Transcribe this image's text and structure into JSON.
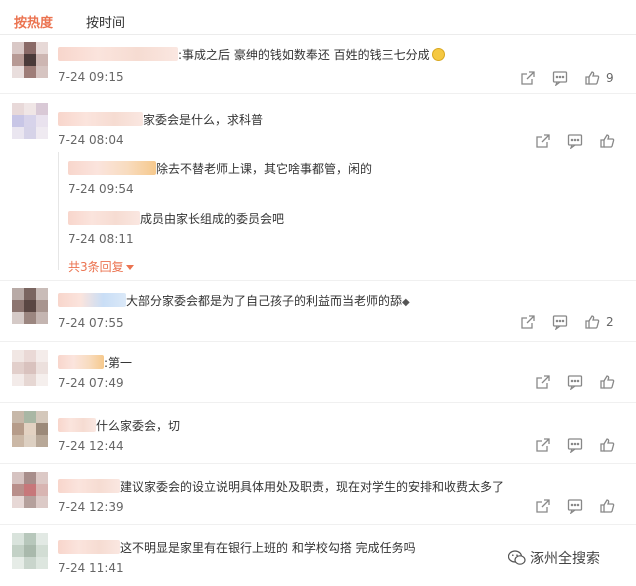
{
  "tabs": [
    {
      "label": "按热度",
      "active": true
    },
    {
      "label": "按时间",
      "active": false
    }
  ],
  "comments": [
    {
      "text": ":事成之后 豪绅的钱如数奉还 百姓的钱三七分成",
      "time": "7-24 09:15",
      "likes": "9",
      "has_emoji": "laughing-face"
    },
    {
      "text": "家委会是什么，求科普",
      "time": "7-24 08:04",
      "likes": ""
    },
    {
      "text": "大部分家委会都是为了自己孩子的利益而当老师的舔",
      "time": "7-24 07:55",
      "likes": "2",
      "has_emoji": "gem"
    },
    {
      "text": ":第一",
      "time": "7-24 07:49",
      "likes": ""
    },
    {
      "text": "什么家委会，切",
      "time": "7-24 12:44",
      "likes": ""
    },
    {
      "text": "建议家委会的设立说明具体用处及职责，现在对学生的安排和收费太多了",
      "time": "7-24 12:39",
      "likes": ""
    },
    {
      "text": "这不明显是家里有在银行上班的 和学校勾搭 完成任务吗",
      "time": "7-24 11:41",
      "likes": ""
    }
  ],
  "replies": [
    {
      "text": "除去不替老师上课，其它啥事都管，闲的",
      "time": "7-24 09:54"
    },
    {
      "text": "成员由家长组成的委员会吧",
      "time": "7-24 08:11"
    }
  ],
  "more_replies": "共3条回复",
  "watermark": "涿州全搜索",
  "colors": {
    "accent": "#eb7350",
    "text": "#333333",
    "muted": "#666666"
  },
  "icons": [
    "share-icon",
    "comment-icon",
    "like-icon"
  ]
}
